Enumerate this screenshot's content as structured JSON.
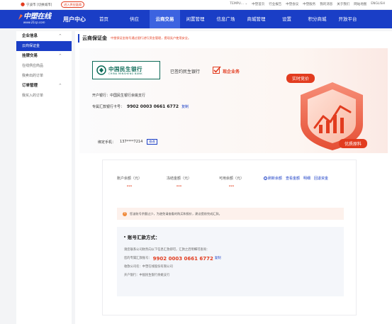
{
  "topbar": {
    "location": "宁波市 [切换城市]",
    "enter_label": "进入供应链商",
    "links": [
      "TEMPU... ⌄",
      "中塑首页",
      "行业报告",
      "中塑会议",
      "中塑服务",
      "我的消息",
      "关于我们",
      "网站地图",
      "ENGLISH"
    ]
  },
  "nav": {
    "logo_text": "中塑在线",
    "logo_sub": "www.21cp.com",
    "user_center": "用户中心",
    "items": [
      "首页",
      "供应",
      "云商交易",
      "闲置管理",
      "信息广场",
      "商城管理",
      "设置",
      "积分商城",
      "开放平台"
    ],
    "active_index": 2
  },
  "sidebar": {
    "groups": [
      {
        "label": "企业信息",
        "caret": "^",
        "items": [
          "云商保证金"
        ]
      },
      {
        "label": "挂牌交易",
        "caret": "^",
        "items": [
          "在线供应商品",
          "我卖出的订单"
        ]
      },
      {
        "label": "订单管理",
        "caret": "^",
        "items": [
          "我买入的订单"
        ]
      }
    ],
    "active_item": "云商保证金"
  },
  "page": {
    "title": "云商保证金",
    "notice": "中塑保证金账号通过银行进行资金管理，提现无户使用安全。"
  },
  "hero": {
    "bank_cn": "中国民生银行",
    "bank_en": "CHINA MINSHENG BANK",
    "partner_text": "已签约民生银行",
    "enterprise_text": "现企业务",
    "open_bank": "开户银行：中国民生银行余姚支行",
    "acct_label": "专属汇款银行卡号：",
    "acct_number": "9902 0003 0661 6772",
    "copy_label": "复制",
    "illus_top": "实时竞价",
    "illus_bottom": "优质原料",
    "colors": {
      "accent": "#e23c1f",
      "bank_green": "#0d6b58",
      "brand": "#1a3ec6"
    }
  },
  "phone": {
    "label": "绑定手机：",
    "value": "137****7214",
    "modify": "修改"
  },
  "balances": [
    {
      "label": "账户余额（元）",
      "value": "***"
    },
    {
      "label": "冻结金额（元）",
      "value": "***"
    },
    {
      "label": "可用余额（元）",
      "value": "***"
    }
  ],
  "actions": [
    "刷新余额",
    "查看金额",
    "明细",
    "回退资金"
  ],
  "warning": "您该账号余额过少，为避免请查看的购买和报价，建议提前完成汇款。",
  "remit": {
    "heading": "账号汇款方式：",
    "line1": "请您联系公司财务向以下信息汇款即可，汇款之后明细可查询：",
    "line2_label": "您的专属汇款账号：",
    "line2_number": "9902 0003 0661 6772",
    "line2_copy": "复制",
    "line3": "收款公司名：中塑在线股份有限公司",
    "line4": "开户银行：中国民生银行余姚支行"
  }
}
